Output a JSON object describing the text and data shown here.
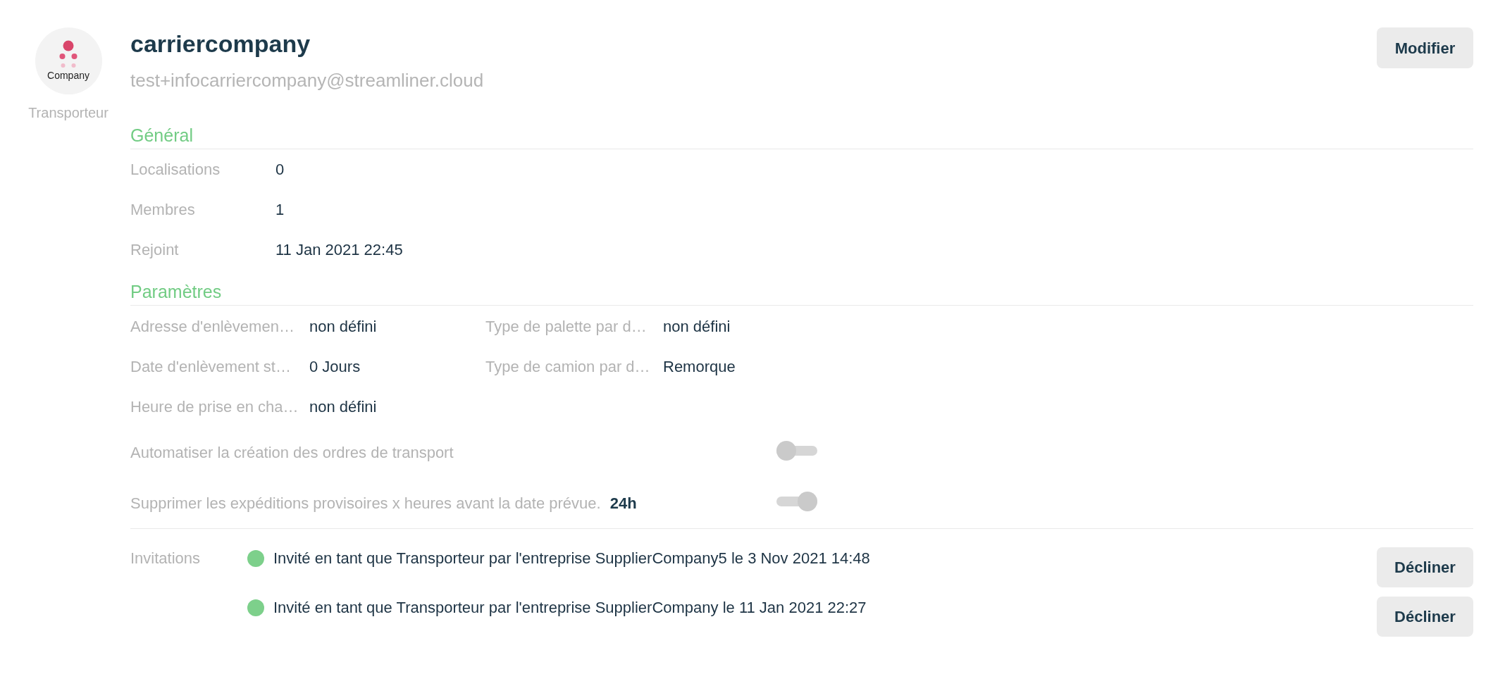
{
  "sidebar": {
    "logo_text": "Company",
    "role": "Transporteur"
  },
  "header": {
    "title": "carriercompany",
    "email": "test+infocarriercompany@streamliner.cloud",
    "edit_button": "Modifier"
  },
  "general": {
    "heading": "Général",
    "rows": [
      {
        "label": "Localisations",
        "value": "0"
      },
      {
        "label": "Membres",
        "value": "1"
      },
      {
        "label": "Rejoint",
        "value": "11 Jan 2021 22:45"
      }
    ]
  },
  "parameters": {
    "heading": "Paramètres",
    "rows": [
      {
        "cells": [
          {
            "label": "Adresse d'enlèvemen…",
            "value": "non défini"
          },
          {
            "label": "Type de palette par d…",
            "value": "non défini"
          }
        ]
      },
      {
        "cells": [
          {
            "label": "Date d'enlèvement st…",
            "value": "0 Jours"
          },
          {
            "label": "Type de camion par d…",
            "value": "Remorque"
          }
        ]
      },
      {
        "cells": [
          {
            "label": "Heure de prise en cha…",
            "value": "non défini"
          }
        ]
      }
    ]
  },
  "toggles": [
    {
      "label": "Automatiser la création des ordres de transport",
      "on": false
    },
    {
      "label": "Supprimer les expéditions provisoires x heures avant la date prévue.",
      "value": "24h",
      "on": true
    }
  ],
  "invitations": {
    "label": "Invitations",
    "items": [
      {
        "text": "Invité en tant que Transporteur par l'entreprise SupplierCompany5 le 3 Nov 2021 14:48",
        "button": "Décliner"
      },
      {
        "text": "Invité en tant que Transporteur par l'entreprise SupplierCompany le 11 Jan 2021 22:27",
        "button": "Décliner"
      }
    ]
  }
}
